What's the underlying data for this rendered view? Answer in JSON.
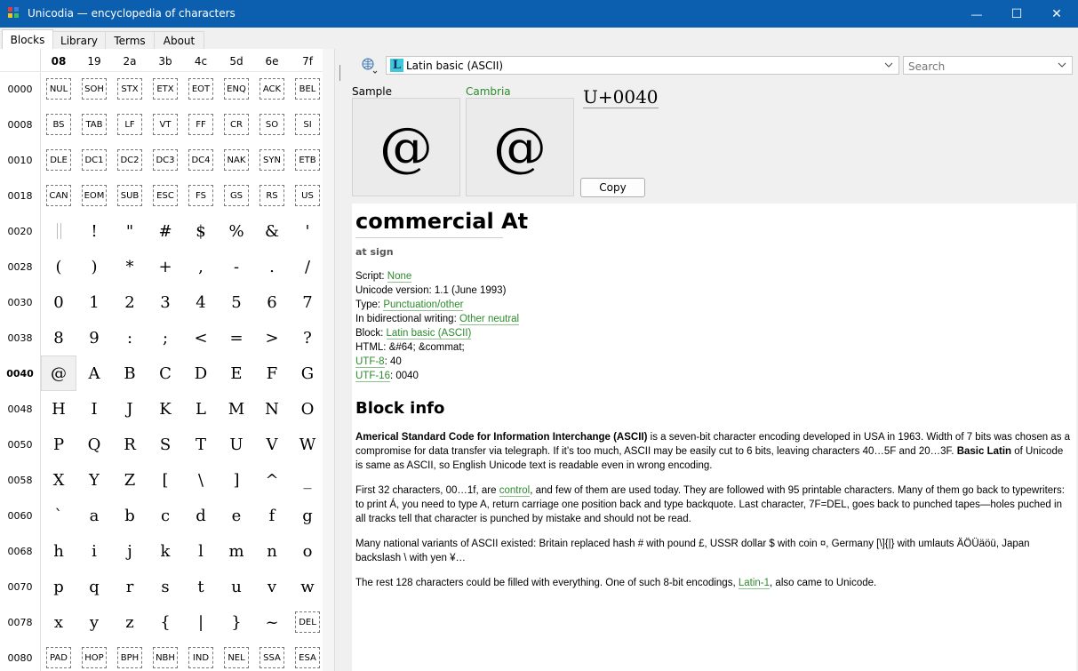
{
  "window": {
    "title": "Unicodia — encyclopedia of characters",
    "minimize_glyph": "—",
    "maximize_glyph": "☐",
    "close_glyph": "✕"
  },
  "tabs": [
    "Blocks",
    "Library",
    "Terms",
    "About"
  ],
  "grid": {
    "columns": [
      "08",
      "19",
      "2a",
      "3b",
      "4c",
      "5d",
      "6e",
      "7f"
    ],
    "rows": [
      {
        "label": "0000",
        "cells": [
          "NUL",
          "SOH",
          "STX",
          "ETX",
          "EOT",
          "ENQ",
          "ACK",
          "BEL"
        ]
      },
      {
        "label": "0008",
        "cells": [
          "BS",
          "TAB",
          "LF",
          "VT",
          "FF",
          "CR",
          "SO",
          "SI"
        ]
      },
      {
        "label": "0010",
        "cells": [
          "DLE",
          "DC1",
          "DC2",
          "DC3",
          "DC4",
          "NAK",
          "SYN",
          "ETB"
        ]
      },
      {
        "label": "0018",
        "cells": [
          "CAN",
          "EOM",
          "SUB",
          "ESC",
          "FS",
          "GS",
          "RS",
          "US"
        ]
      },
      {
        "label": "0020",
        "cells": [
          " ",
          "!",
          "\"",
          "#",
          "$",
          "%",
          "&",
          "'"
        ]
      },
      {
        "label": "0028",
        "cells": [
          "(",
          ")",
          "*",
          "+",
          ",",
          "-",
          ".",
          "/"
        ]
      },
      {
        "label": "0030",
        "cells": [
          "0",
          "1",
          "2",
          "3",
          "4",
          "5",
          "6",
          "7"
        ]
      },
      {
        "label": "0038",
        "cells": [
          "8",
          "9",
          ":",
          ";",
          "<",
          "=",
          ">",
          "?"
        ]
      },
      {
        "label": "0040",
        "cells": [
          "@",
          "A",
          "B",
          "C",
          "D",
          "E",
          "F",
          "G"
        ]
      },
      {
        "label": "0048",
        "cells": [
          "H",
          "I",
          "J",
          "K",
          "L",
          "M",
          "N",
          "O"
        ]
      },
      {
        "label": "0050",
        "cells": [
          "P",
          "Q",
          "R",
          "S",
          "T",
          "U",
          "V",
          "W"
        ]
      },
      {
        "label": "0058",
        "cells": [
          "X",
          "Y",
          "Z",
          "[",
          "\\",
          "]",
          "^",
          "_"
        ]
      },
      {
        "label": "0060",
        "cells": [
          "`",
          "a",
          "b",
          "c",
          "d",
          "e",
          "f",
          "g"
        ]
      },
      {
        "label": "0068",
        "cells": [
          "h",
          "i",
          "j",
          "k",
          "l",
          "m",
          "n",
          "o"
        ]
      },
      {
        "label": "0070",
        "cells": [
          "p",
          "q",
          "r",
          "s",
          "t",
          "u",
          "v",
          "w"
        ]
      },
      {
        "label": "0078",
        "cells": [
          "x",
          "y",
          "z",
          "{",
          "|",
          "}",
          "~",
          "DEL"
        ]
      },
      {
        "label": "0080",
        "cells": [
          "PAD",
          "HOP",
          "BPH",
          "NBH",
          "IND",
          "NEL",
          "SSA",
          "ESA"
        ]
      }
    ]
  },
  "block_selector": {
    "icon_letter": "L",
    "value": "Latin basic (ASCII)"
  },
  "search": {
    "placeholder": "Search"
  },
  "sample": {
    "label": "Sample",
    "font_link": "Cambria",
    "glyph": "@",
    "code": "U+0040",
    "copy_label": "Copy"
  },
  "char": {
    "name": "commercial At",
    "alias": "at sign",
    "props": [
      {
        "key": "Script: ",
        "link": "None",
        "rest": ""
      },
      {
        "key": "Unicode version: 1.1 (June 1993)",
        "link": "",
        "rest": ""
      },
      {
        "key": "Type: ",
        "link": "Punctuation/other",
        "rest": ""
      },
      {
        "key": "In bidirectional writing: ",
        "link": "Other neutral",
        "rest": ""
      },
      {
        "key": "Block: ",
        "link": "Latin basic (ASCII)",
        "rest": ""
      },
      {
        "key": "HTML: &#64; &commat;",
        "link": "",
        "rest": ""
      },
      {
        "key": "",
        "link": "UTF-8",
        "rest": ": 40"
      },
      {
        "key": "",
        "link": "UTF-16",
        "rest": ": 0040"
      }
    ]
  },
  "block_info": {
    "title": "Block info",
    "p1_bold": "Americal Standard Code for Information Interchange (ASCII)",
    "p1_a": " is a seven-bit character encoding developed in USA in 1963. Width of 7 bits was chosen as a compromise for data transfer via telegraph. If it’s too much, ASCII may be easily cut to 6 bits, leaving characters 40…5F and 20…3F. ",
    "p1_bold2": "Basic Latin",
    "p1_b": " of Unicode is same as ASCII, so English Unicode text is readable even in wrong encoding.",
    "p2_a": "First 32 characters, 00…1f, are ",
    "p2_link": "control",
    "p2_b": ", and few of them are used today. They are followed with 95 printable characters. Many of them go back to typewriters: to print Á, you need to type A, return carriage one position back and type backquote. Last character, 7F=DEL, goes back to punched tapes—holes puched in all tracks tell that character is punched by mistake and should not be read.",
    "p3": "Many national variants of ASCII existed: Britain replaced hash # with pound £, USSR dollar $ with coin ¤, Germany [\\]{|} with umlauts ÄÖÜäöü, Japan backslash \\ with yen ¥…",
    "p4_a": "The rest 128 characters could be filled with everything. One of such 8-bit encodings, ",
    "p4_link": "Latin-1",
    "p4_b": ", also came to Unicode."
  },
  "colors": {
    "titlebar": "#0b5fae",
    "link": "#2d8a2d",
    "accent_cyan": "#3ec8d8"
  }
}
